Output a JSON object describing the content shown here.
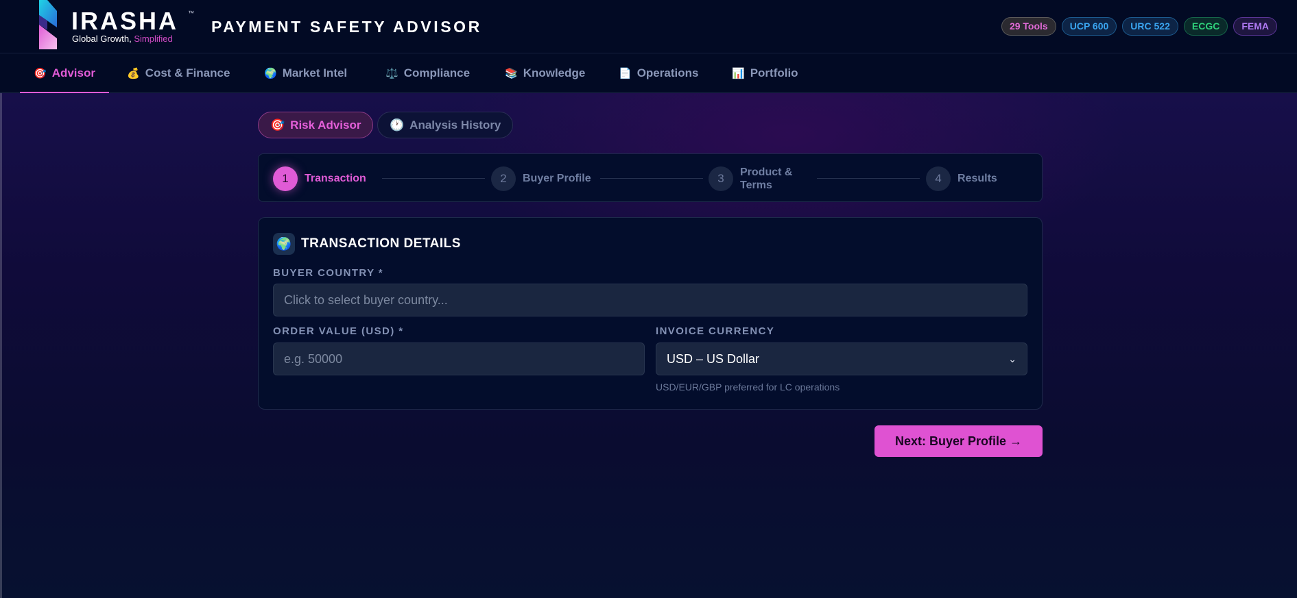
{
  "brand": {
    "name": "IRASHA",
    "trademark": "™",
    "tagline_prefix": "Global Growth, ",
    "tagline_highlight": "Simplified",
    "app_title": "PAYMENT SAFETY ADVISOR"
  },
  "badges": [
    "29 Tools",
    "UCP 600",
    "URC 522",
    "ECGC",
    "FEMA"
  ],
  "nav": {
    "items": [
      {
        "label": "Advisor",
        "icon": "🎯"
      },
      {
        "label": "Cost & Finance",
        "icon": "💰"
      },
      {
        "label": "Market Intel",
        "icon": "🌍"
      },
      {
        "label": "Compliance",
        "icon": "⚖️"
      },
      {
        "label": "Knowledge",
        "icon": "📚"
      },
      {
        "label": "Operations",
        "icon": "📄"
      },
      {
        "label": "Portfolio",
        "icon": "📊"
      }
    ],
    "active": "Advisor"
  },
  "subtabs": [
    {
      "label": "Risk Advisor",
      "icon": "🎯"
    },
    {
      "label": "Analysis History",
      "icon": "🕐"
    }
  ],
  "stepper": [
    {
      "num": "1",
      "label": "Transaction"
    },
    {
      "num": "2",
      "label": "Buyer Profile"
    },
    {
      "num": "3",
      "label_line1": "Product &",
      "label_line2": "Terms"
    },
    {
      "num": "4",
      "label": "Results"
    }
  ],
  "card": {
    "icon": "🌍",
    "title": "TRANSACTION DETAILS",
    "buyer_country_label": "BUYER COUNTRY *",
    "buyer_country_placeholder": "Click to select buyer country...",
    "order_value_label": "ORDER VALUE (USD) *",
    "order_value_placeholder": "e.g. 50000",
    "invoice_currency_label": "INVOICE CURRENCY",
    "invoice_currency_value": "USD – US Dollar",
    "invoice_currency_hint": "USD/EUR/GBP preferred for LC operations"
  },
  "next_button": "Next: Buyer Profile →",
  "colors": {
    "accent": "#e05bd6",
    "background": "#040b24",
    "card": "#030d2c"
  }
}
